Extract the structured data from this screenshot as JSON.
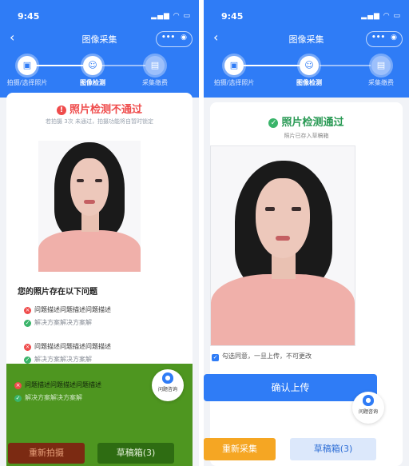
{
  "left": {
    "status_time": "9:45",
    "title": "图像采集",
    "steps": [
      "拍摄/选择照片",
      "图像检测",
      "采集缴费"
    ],
    "result_title": "照片检测不通过",
    "result_note": "若拍摄 3次 未通过，拍摄功能将自暂时锁定",
    "issues_heading": "您的照片存在以下问题",
    "issues": [
      {
        "problem": "问题描述问题描述问题描述",
        "solution": "解决方案解决方案解"
      },
      {
        "problem": "问题描述问题描述问题描述",
        "solution": "解决方案解决方案解"
      },
      {
        "problem": "问题描述问题描述问题描述",
        "solution": "解决方案解决方案解"
      }
    ],
    "float_label": "问题咨询",
    "retake_label": "重新拍摄",
    "drafts_label": "草稿箱(3)"
  },
  "right": {
    "status_time": "9:45",
    "title": "图像采集",
    "steps": [
      "拍摄/选择照片",
      "图像检测",
      "采集缴费"
    ],
    "result_title": "照片检测通过",
    "result_note": "照片已存入草稿箱",
    "agree_text": "勾选同意，一旦上传，不可更改",
    "confirm_label": "确认上传",
    "float_label": "问题咨询",
    "recollect_label": "重新采集",
    "drafts_label": "草稿箱(3)"
  },
  "colors": {
    "primary": "#2f7cf6",
    "error": "#ef4b4b",
    "success": "#3ab46a",
    "warning": "#f5a623",
    "overlay_green": "#3f8d0d"
  }
}
